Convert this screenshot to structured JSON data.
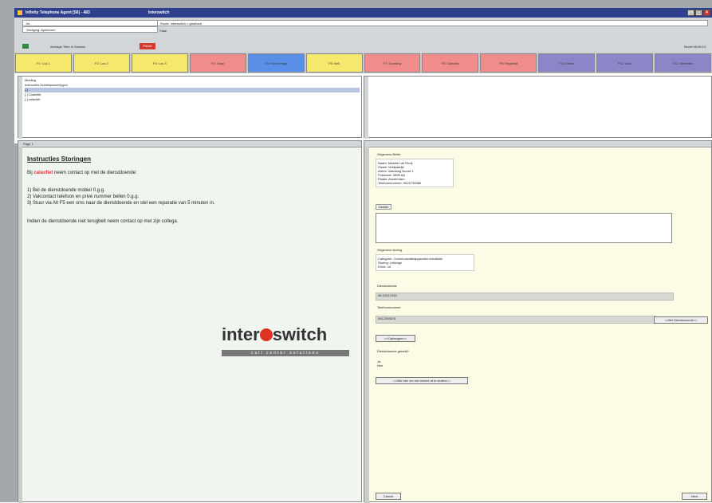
{
  "window": {
    "title": "Infinity Telephone Agent [56] - 483",
    "subtitle": "Interswitch"
  },
  "toolbar": {
    "label_mark": "Inl.",
    "pause_label": "Pauze",
    "agent_label": "Average Time in Session",
    "status_right": "Bezet 08:26:10",
    "field_r1": "Bedrijf: interswitch.tsl",
    "field_r2": "Vestiging: Apeldoorn",
    "field_r3": "Route: interswitch > gearbeid",
    "field_r4": "Fase:"
  },
  "fkeys": [
    {
      "label": "F1: Lus 1",
      "color": "#f6e86c"
    },
    {
      "label": "F2: Lus 2",
      "color": "#f6e86c"
    },
    {
      "label": "F3: Lus 3",
      "color": "#f6e86c"
    },
    {
      "label": "F4: Gasp",
      "color": "#f08d8c"
    },
    {
      "label": "F5: Home Page",
      "color": "#5a8fe8"
    },
    {
      "label": "F6: Bell",
      "color": "#f6e86c"
    },
    {
      "label": "F7: Doorklvg",
      "color": "#f08d8c"
    },
    {
      "label": "F8: Ophalen",
      "color": "#f08d8c"
    },
    {
      "label": "F9: Registrat",
      "color": "#f08d8c"
    },
    {
      "label": "F10: Menu",
      "color": "#8a86c8"
    },
    {
      "label": "F11: Lnsk",
      "color": "#8a86c8"
    },
    {
      "label": "F12: Afmelden",
      "color": "#8a86c8"
    }
  ],
  "tree": {
    "root": "Melding",
    "items": [
      "Instructies Dubbelpasseringen",
      "[-]",
      "[-]  Calaxfiet",
      "[-]  calaxfiet"
    ]
  },
  "lower_left": {
    "header": "Page 1",
    "instr_title": "Instructies Storingen",
    "line1_pre": "Bij",
    "line1_red": "calaxfiet",
    "line1_post": "neem contact op met de dienstdoende:",
    "steps": [
      "1) Bel de dienstdoende mobiel 0.g.g.",
      "2) Vakcontact telefoon en privé nummer bellen 0.g.g.",
      "3) Stuur via Alt F5 een sms naar de dienstdoende en stel een reparatie van 5 minuten in."
    ],
    "line_end": "Indien de dienstdoende niet terugbelt neem contact op met zijn collega.",
    "logo_left": "inter",
    "logo_right": "switch",
    "logo_sub": "call center solutions"
  },
  "right_form": {
    "sec1_title": "Gegevens Beller",
    "sec1_lines": [
      "Naam: Maarten de Rooij",
      "Straat: Veldpaadje",
      "Adres: Vaartweg Noord 1",
      "Postcode: 3895 AA",
      "Plaats: Amsterdam",
      "Telefoonnummer: 0620736380"
    ],
    "tab_label": "Details",
    "sec2_title": "Gegevens storing",
    "sec2_lines": [
      "Categorie: Communicatieapparaten installatie",
      "Storing: Lekkage",
      "Ernst: Ja"
    ],
    "label_sms": "Dienstdoende",
    "sms_value": "06-12012345",
    "label_tel": "Telefoonnummer",
    "tel_value": "0612345678",
    "btn_tel": "<<Bel Dienstdoende>>",
    "btn_ophangen": "<<Ophangen>>",
    "label_question": "Dienstdoende gebeld?",
    "answers": [
      "Ja",
      "Nee"
    ],
    "btn_continue": "<<Klik hier om het bericht af te sluiten>>",
    "btn_cancel": "Cancel",
    "btn_next": "Next"
  }
}
